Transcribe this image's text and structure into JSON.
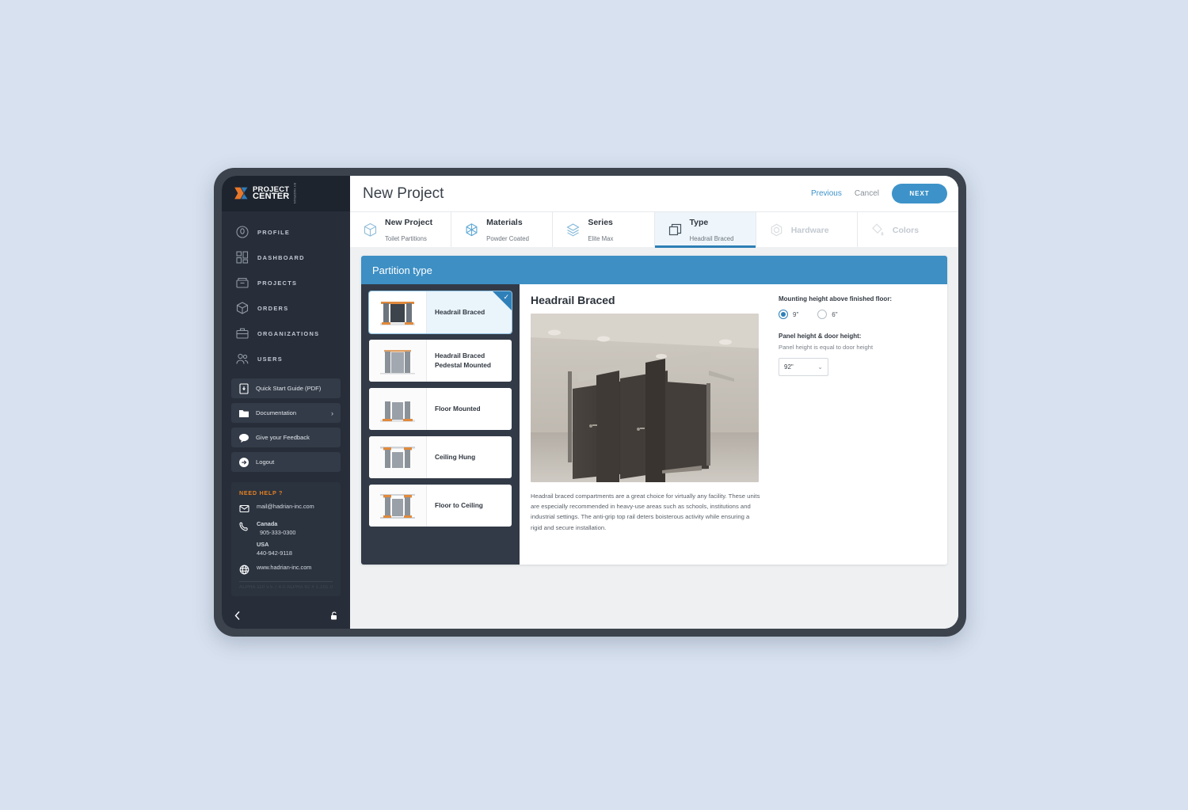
{
  "brand": {
    "logo_line1": "PROJECT",
    "logo_line2": "CENTER",
    "logo_sub": "BY HADRIAN",
    "accent_orange": "#e58021",
    "accent_blue": "#3d93c9"
  },
  "sidebar": {
    "nav": [
      {
        "label": "PROFILE",
        "icon": "profile-icon"
      },
      {
        "label": "DASHBOARD",
        "icon": "dashboard-icon"
      },
      {
        "label": "PROJECTS",
        "icon": "projects-icon"
      },
      {
        "label": "ORDERS",
        "icon": "orders-icon"
      },
      {
        "label": "ORGANIZATIONS",
        "icon": "organizations-icon"
      },
      {
        "label": "USERS",
        "icon": "users-icon"
      }
    ],
    "buttons": [
      {
        "label": "Quick Start Guide (PDF)",
        "icon": "pdf-icon"
      },
      {
        "label": "Documentation",
        "icon": "folder-icon",
        "chevron": "›"
      },
      {
        "label": "Give your Feedback",
        "icon": "chat-icon"
      },
      {
        "label": "Logout",
        "icon": "logout-icon"
      }
    ],
    "help": {
      "title": "NEED HELP ?",
      "email": "mail@hadrian-inc.com",
      "country1": "Canada",
      "phone1": "905-333-0300",
      "country2": "USA",
      "phone2": "440-942-9118",
      "website": "www.hadrian-inc.com",
      "version": "ALPHA 110 v.5.7.4.0  ALPHA 92  # 1.101.0"
    }
  },
  "topbar": {
    "title": "New Project",
    "previous": "Previous",
    "cancel": "Cancel",
    "next": "NEXT"
  },
  "steps": [
    {
      "name": "New Project",
      "sub": "Toilet Partitions",
      "icon": "cube-icon",
      "state": "done"
    },
    {
      "name": "Materials",
      "sub": "Powder Coated",
      "icon": "hex-icon",
      "state": "done"
    },
    {
      "name": "Series",
      "sub": "Elite Max",
      "icon": "layers-icon",
      "state": "done"
    },
    {
      "name": "Type",
      "sub": "Headrail Braced",
      "icon": "panels-icon",
      "state": "active"
    },
    {
      "name": "Hardware",
      "sub": "",
      "icon": "nut-icon",
      "state": "disabled"
    },
    {
      "name": "Colors",
      "sub": "",
      "icon": "paint-icon",
      "state": "disabled"
    }
  ],
  "panel": {
    "heading": "Partition type",
    "types": [
      {
        "label": "Headrail Braced",
        "selected": true
      },
      {
        "label": "Headrail Braced Pedestal Mounted",
        "selected": false
      },
      {
        "label": "Floor Mounted",
        "selected": false
      },
      {
        "label": "Ceiling Hung",
        "selected": false
      },
      {
        "label": "Floor to Ceiling",
        "selected": false
      }
    ],
    "detail": {
      "title": "Headrail Braced",
      "description": "Headrail braced compartments are a great choice for virtually any facility. These units are especially recommended in heavy-use areas such as schools, institutions and industrial settings. The anti-grip top rail deters boisterous activity while ensuring a rigid and secure installation.",
      "mounting_label": "Mounting height above finished floor:",
      "mounting_options": [
        {
          "label": "9\"",
          "selected": true
        },
        {
          "label": "6\"",
          "selected": false
        }
      ],
      "panel_height_label": "Panel height & door height:",
      "panel_height_note": "Panel height is equal to door height",
      "panel_height_value": "92\"",
      "panel_height_chevron": "⌵"
    }
  }
}
